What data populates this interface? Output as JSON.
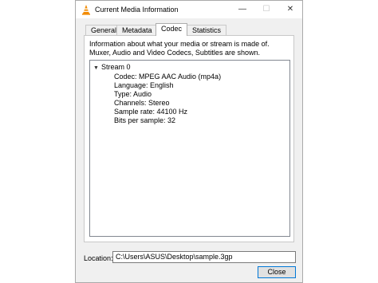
{
  "window": {
    "title": "Current Media Information",
    "minimize_glyph": "—",
    "maximize_glyph": "☐",
    "close_glyph": "✕"
  },
  "tabs": [
    {
      "label": "General"
    },
    {
      "label": "Metadata"
    },
    {
      "label": "Codec"
    },
    {
      "label": "Statistics"
    }
  ],
  "active_tab": "Codec",
  "codec": {
    "description": "Information about what your media or stream is made of. Muxer, Audio and Video Codecs, Subtitles are shown.",
    "stream": {
      "label": "Stream 0",
      "details": [
        "Codec: MPEG AAC Audio (mp4a)",
        "Language: English",
        "Type: Audio",
        "Channels: Stereo",
        "Sample rate: 44100 Hz",
        "Bits per sample: 32"
      ]
    }
  },
  "location": {
    "label": "Location:",
    "value": "C:\\Users\\ASUS\\Desktop\\sample.3gp"
  },
  "buttons": {
    "close": "Close"
  },
  "icons": {
    "app": "vlc-cone-icon",
    "expand": "chevron-down-icon"
  },
  "colors": {
    "vlc_orange": "#f28a00",
    "accent_border": "#0078d7"
  }
}
